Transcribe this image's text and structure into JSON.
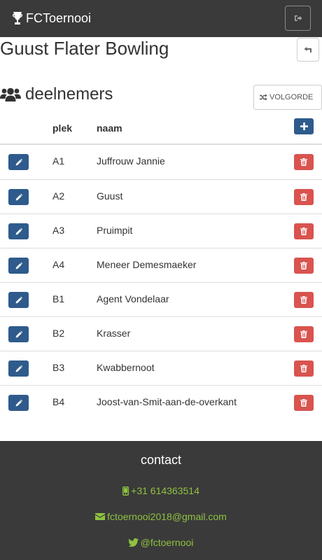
{
  "navbar": {
    "brand": "FCToernooi",
    "brand_icon": "trophy-icon",
    "logout_icon": "sign-out-icon"
  },
  "page": {
    "title": "Guust Flater Bowling",
    "back_icon": "reply-icon"
  },
  "participants": {
    "title": "deelnemers",
    "title_icon": "users-icon",
    "order_button": "VOLGORDE",
    "order_icon": "random-icon",
    "columns": {
      "place": "plek",
      "name": "naam"
    },
    "add_icon": "plus-icon",
    "rows": [
      {
        "place": "A1",
        "name": "Juffrouw Jannie"
      },
      {
        "place": "A2",
        "name": "Guust"
      },
      {
        "place": "A3",
        "name": "Pruimpit"
      },
      {
        "place": "A4",
        "name": "Meneer Demesmaeker"
      },
      {
        "place": "B1",
        "name": "Agent Vondelaar"
      },
      {
        "place": "B2",
        "name": "Krasser"
      },
      {
        "place": "B3",
        "name": "Kwabbernoot"
      },
      {
        "place": "B4",
        "name": "Joost-van-Smit-aan-de-overkant"
      }
    ]
  },
  "footer": {
    "title": "contact",
    "phone": "+31 614363514",
    "email": "fctoernooi2018@gmail.com",
    "twitter": "@fctoernooi"
  },
  "colors": {
    "dark": "#3a3a3a",
    "primary": "#2e5b8c",
    "danger": "#d9534f",
    "link": "#8fc23f"
  }
}
